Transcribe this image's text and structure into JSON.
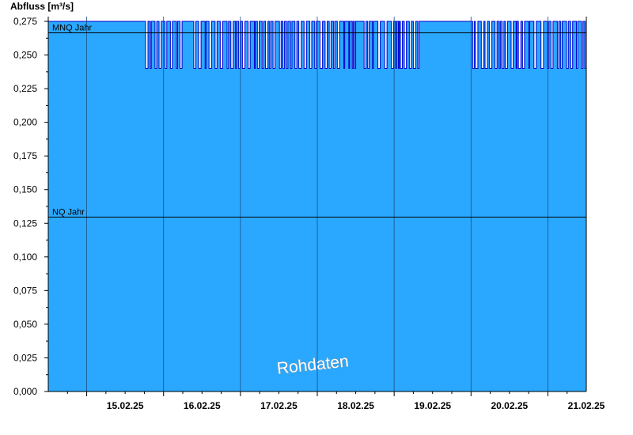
{
  "chart_data": {
    "type": "area",
    "title": "",
    "ylabel": "Abfluss [m³/s]",
    "xlabel": "",
    "ylim": [
      0,
      0.275
    ],
    "xlim_days": [
      "14.02.25 12:00",
      "21.02.25 12:00"
    ],
    "y_ticks": [
      "0,275",
      "0,250",
      "0,225",
      "0,200",
      "0,175",
      "0,150",
      "0,125",
      "0,100",
      "0,075",
      "0,050",
      "0,025",
      "0,000"
    ],
    "x_ticks": [
      "15.02.25",
      "16.02.25",
      "17.02.25",
      "18.02.25",
      "19.02.25",
      "20.02.25",
      "21.02.25"
    ],
    "grid": "vertical lines at midnight",
    "series": [
      {
        "color": "#2aa8ff",
        "outline_color": "#0000cc",
        "segments": [
          {
            "from": "14.02.25 12:00",
            "to": "15.02.25 18:00",
            "level": 0.275
          },
          {
            "from": "15.02.25 18:00",
            "to": "16.02.25 06:00",
            "level": "alternating 0.240 / 0.275"
          },
          {
            "from": "16.02.25 06:00",
            "to": "16.02.25 09:00",
            "level": 0.275
          },
          {
            "from": "16.02.25 09:00",
            "to": "18.02.25 12:00",
            "level": "alternating 0.240 / 0.275"
          },
          {
            "from": "18.02.25 12:00",
            "to": "18.02.25 14:00",
            "level": 0.275
          },
          {
            "from": "18.02.25 14:00",
            "to": "19.02.25 09:00",
            "level": "alternating 0.240 / 0.275"
          },
          {
            "from": "19.02.25 09:00",
            "to": "20.02.25 00:00",
            "level": 0.275
          },
          {
            "from": "20.02.25 00:00",
            "to": "21.02.25 12:00",
            "level": "alternating 0.240 / 0.275"
          }
        ]
      }
    ],
    "reference_lines": [
      {
        "label": "MNQ Jahr",
        "value": 0.2665,
        "color": "#000000"
      },
      {
        "label": "NQ Jahr",
        "value": 0.13,
        "color": "#000000"
      }
    ],
    "watermark": "Rohdaten"
  }
}
